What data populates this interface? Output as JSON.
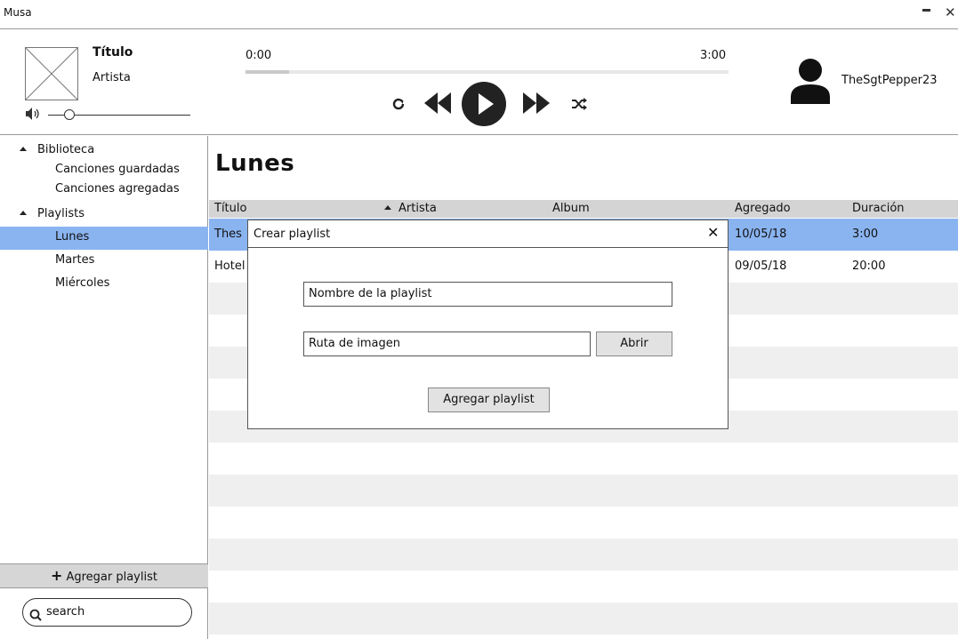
{
  "window": {
    "title": "Musa"
  },
  "player": {
    "track_title": "Título",
    "track_artist": "Artista",
    "current_time": "0:00",
    "total_time": "3:00",
    "progress": 0.09,
    "volume": 0.15
  },
  "user": {
    "name": "TheSgtPepper23"
  },
  "sidebar": {
    "groups": [
      {
        "label": "Biblioteca",
        "items": [
          "Canciones guardadas",
          "Canciones agregadas"
        ]
      },
      {
        "label": "Playlists",
        "items": [
          "Lunes",
          "Martes",
          "Miércoles"
        ]
      }
    ],
    "selected": "Lunes",
    "add_playlist_label": "Agregar playlist",
    "search_placeholder": "search"
  },
  "main": {
    "title": "Lunes",
    "columns": [
      "Título",
      "Artista",
      "Album",
      "Agregado",
      "Duración"
    ],
    "sorted_column": "Artista",
    "rows": [
      {
        "titulo": "Thes",
        "agregado": "10/05/18",
        "duracion": "3:00"
      },
      {
        "titulo": "Hotel",
        "agregado": "09/05/18",
        "duracion": "20:00"
      }
    ]
  },
  "dialog": {
    "title": "Crear playlist",
    "name_placeholder": "Nombre de la playlist",
    "image_placeholder": "Ruta de imagen",
    "open_button": "Abrir",
    "submit_button": "Agregar playlist"
  },
  "colors": {
    "selection": "#8ab4f0",
    "header_gray": "#d4d4d4",
    "row_alt": "#efefef"
  }
}
